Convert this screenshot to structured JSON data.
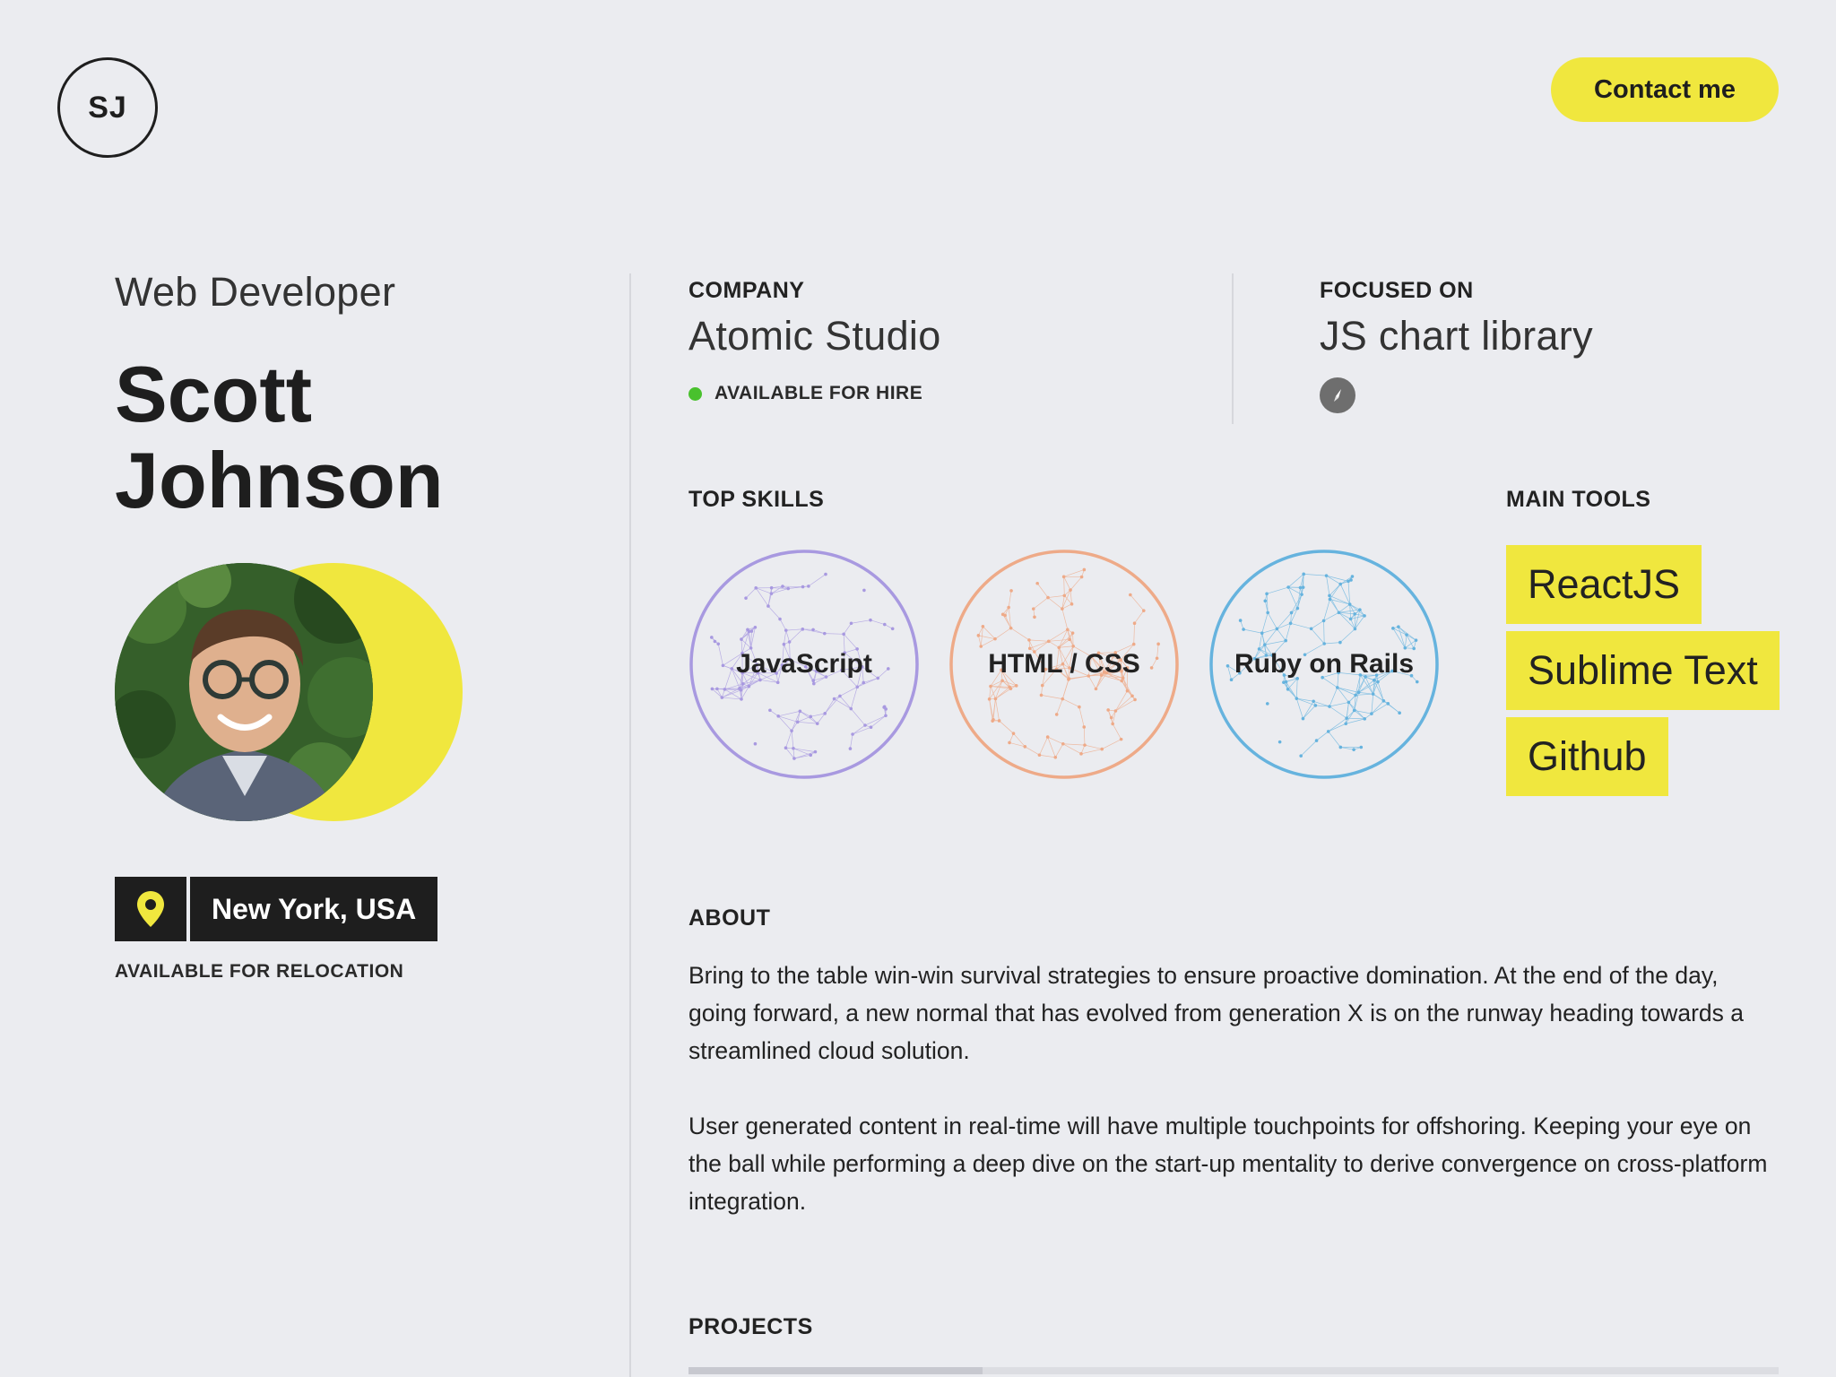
{
  "header": {
    "logo_initials": "SJ",
    "contact_label": "Contact me"
  },
  "profile": {
    "role": "Web Developer",
    "first_name": "Scott",
    "last_name": "Johnson",
    "location": "New York, USA",
    "relocation": "AVAILABLE FOR RELOCATION"
  },
  "company": {
    "label": "COMPANY",
    "value": "Atomic Studio",
    "status": "AVAILABLE FOR HIRE"
  },
  "focus": {
    "label": "FOCUSED ON",
    "value": "JS chart library"
  },
  "skills": {
    "label": "TOP SKILLS",
    "items": [
      {
        "name": "JavaScript",
        "color": "#a899e0"
      },
      {
        "name": "HTML / CSS",
        "color": "#eeaa88"
      },
      {
        "name": "Ruby on Rails",
        "color": "#66b3de"
      }
    ]
  },
  "tools": {
    "label": "MAIN TOOLS",
    "items": [
      "ReactJS",
      "Sublime Text",
      "Github"
    ]
  },
  "about": {
    "label": "ABOUT",
    "paragraphs": [
      "Bring to the table win-win survival strategies to ensure proactive domination. At the end of the day, going forward, a new normal that has evolved from generation X is on the runway heading towards a streamlined cloud solution.",
      "User generated content in real-time will have multiple touchpoints for offshoring. Keeping your eye on the ball while performing a deep dive on the start-up mentality to derive convergence on cross-platform integration."
    ]
  },
  "projects": {
    "label": "PROJECTS",
    "progress": 0.27
  },
  "colors": {
    "accent": "#f0e73e",
    "available": "#49c12d",
    "background": "#ebecf0"
  }
}
